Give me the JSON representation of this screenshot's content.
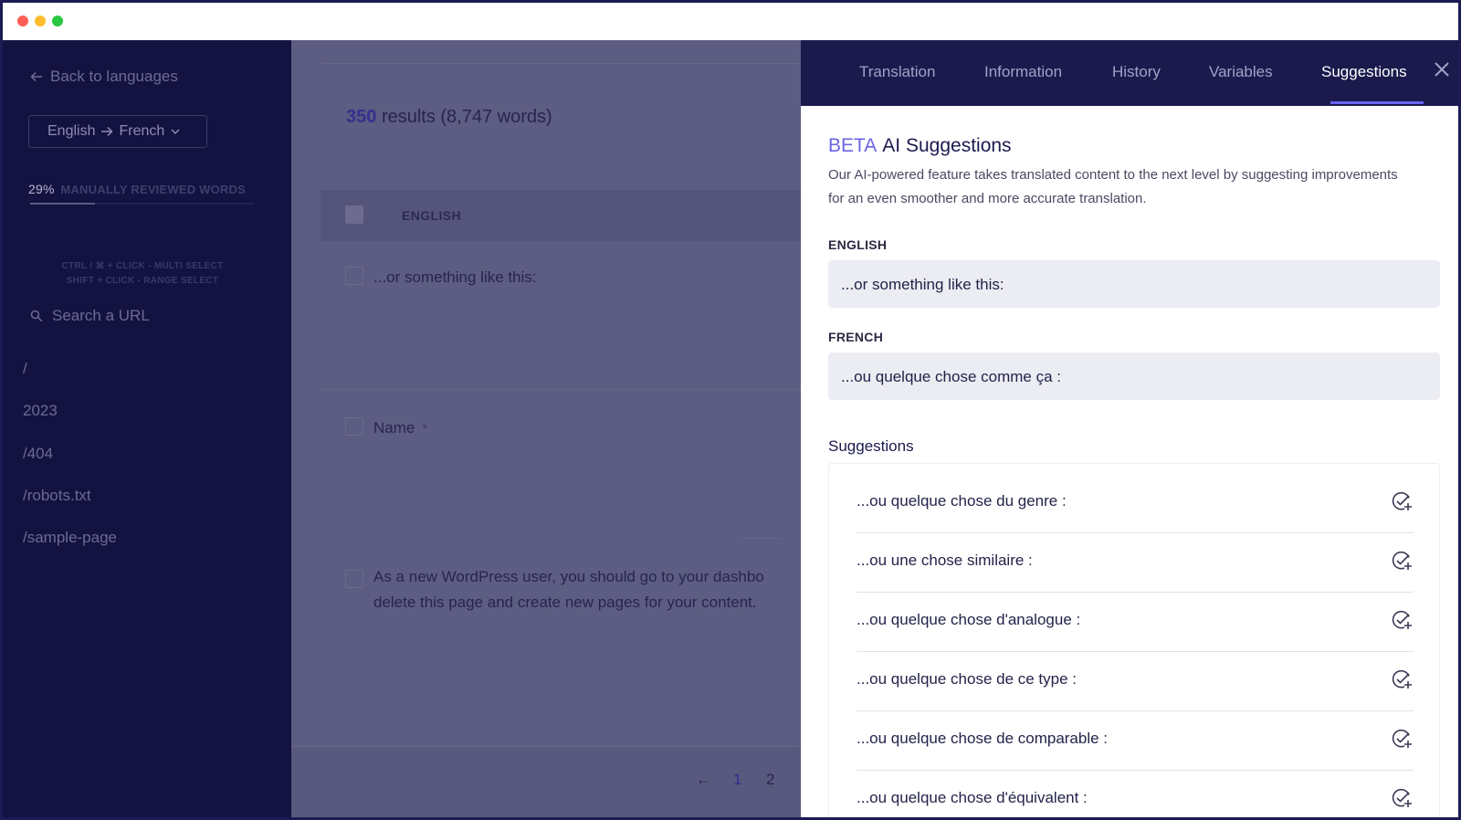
{
  "window": {},
  "sidebar": {
    "back_label": "Back to languages",
    "language_pair": {
      "source": "English",
      "target": "French"
    },
    "progress": {
      "percent_label": "29%",
      "label": "MANUALLY REVIEWED WORDS",
      "value": 0.29
    },
    "hints": [
      "CTRL / ⌘ + CLICK - MULTI SELECT",
      "SHIFT + CLICK - RANGE SELECT"
    ],
    "search_placeholder": "Search a URL",
    "urls": [
      "/",
      "2023",
      "/404",
      "/robots.txt",
      "/sample-page"
    ]
  },
  "main": {
    "results_count": "350",
    "results_label": "results (8,747 words)",
    "column_header": "ENGLISH",
    "rows": [
      {
        "text": "...or something like this:"
      },
      {
        "text": "Name",
        "required_mark": "*"
      },
      {
        "text_line1": "As a new WordPress user, you should go to  your dashbo",
        "text_line2": "delete this page and create new pages for your content."
      }
    ],
    "pagination": {
      "prev": "←",
      "pages": [
        "1",
        "2"
      ],
      "current": "1"
    }
  },
  "panel": {
    "tabs": [
      "Translation",
      "Information",
      "History",
      "Variables",
      "Suggestions"
    ],
    "active_tab": "Suggestions",
    "beta_label": "BETA",
    "title": "AI Suggestions",
    "description": "Our AI-powered feature takes translated content to the next level by suggesting improvements for an even smoother and more accurate translation.",
    "source_label": "ENGLISH",
    "source_text": "...or something like this:",
    "target_label": "FRENCH",
    "target_text": "...ou quelque chose comme ça :",
    "suggestions_title": "Suggestions",
    "suggestions": [
      "...ou quelque chose du genre :",
      "...ou une chose similaire :",
      "...ou quelque chose d'analogue :",
      "...ou quelque chose de ce type :",
      "...ou quelque chose de comparable :",
      "...ou quelque chose d'équivalent :"
    ]
  },
  "colors": {
    "sidebar_bg": "#131241",
    "header_bg": "#1b1a4d",
    "accent": "#6a63f2",
    "field_bg": "#ececf3"
  },
  "icons": {
    "back": "arrow-left-icon",
    "lang_arrow": "arrow-right-icon",
    "dropdown": "chevron-down-icon",
    "search": "search-icon",
    "close": "close-icon",
    "apply": "check-circle-plus-icon"
  }
}
